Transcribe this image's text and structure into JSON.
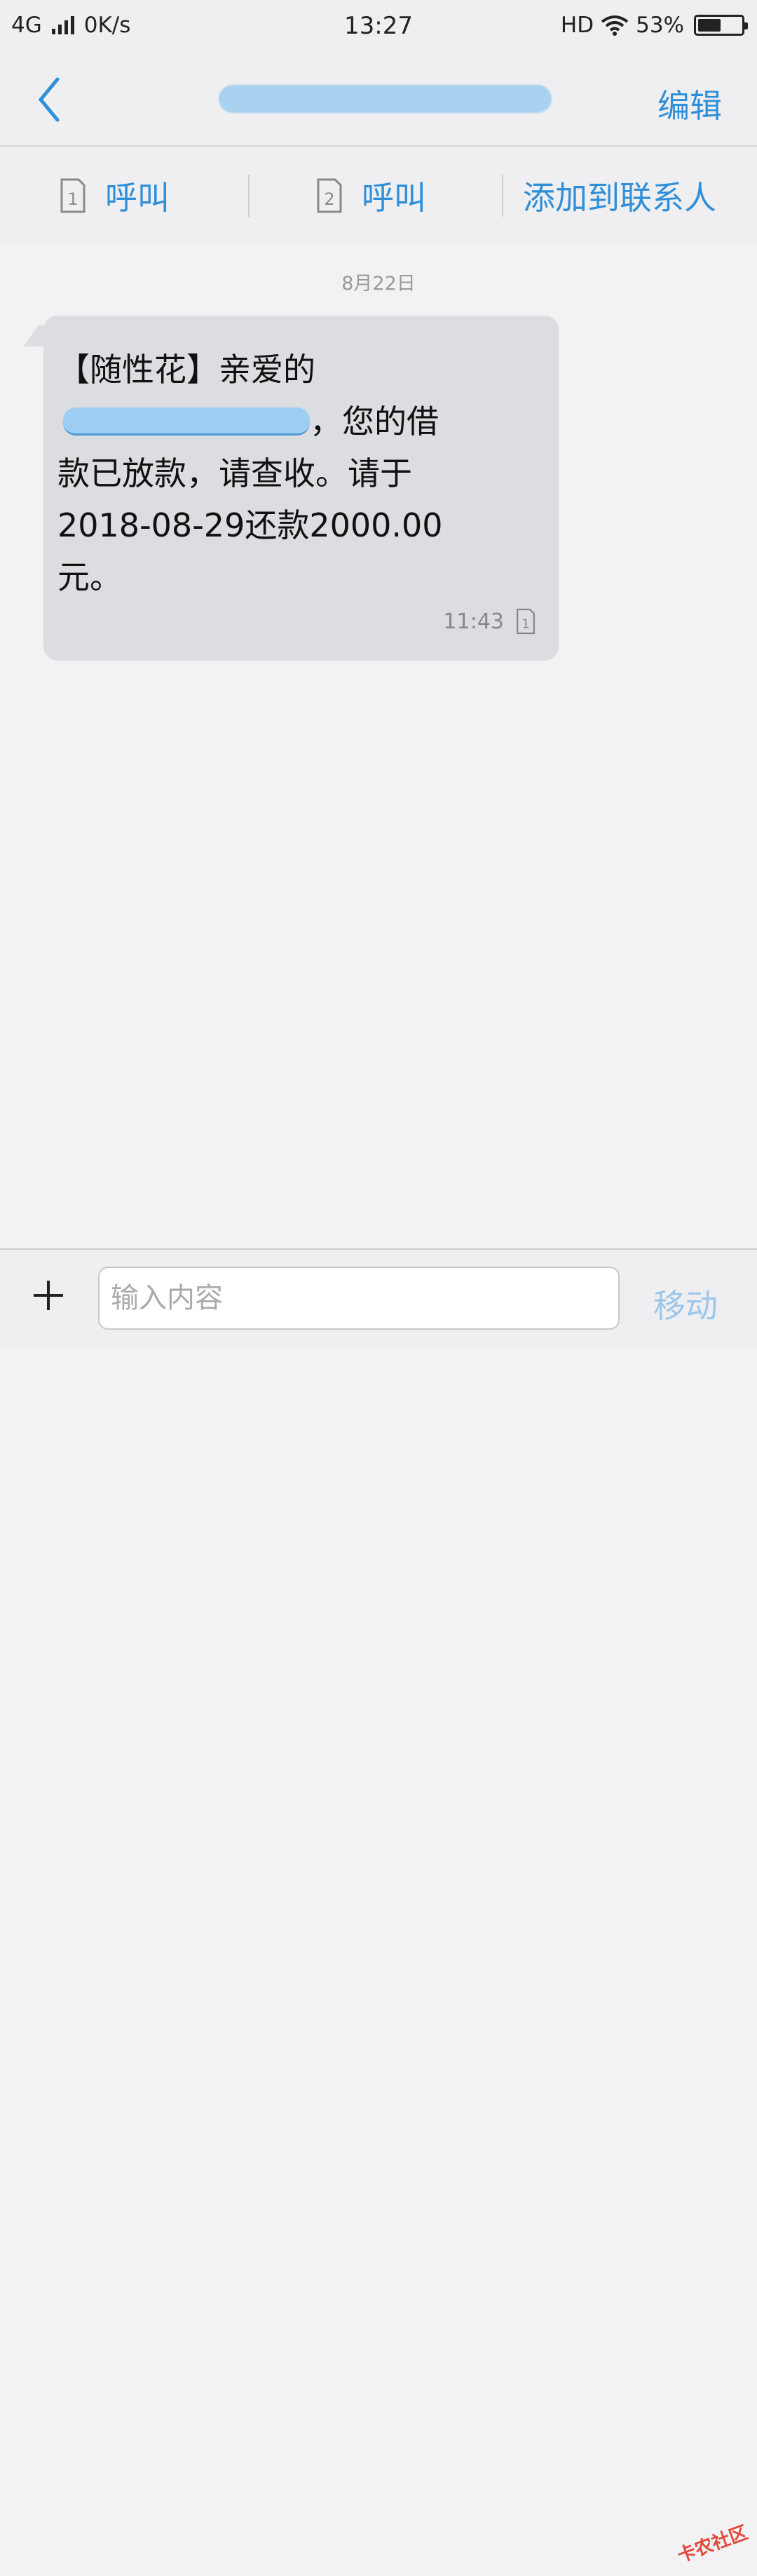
{
  "status_bar": {
    "network": "4G",
    "speed": "0K/s",
    "time": "13:27",
    "hd": "HD",
    "battery_percent_label": "53%",
    "battery_level": 0.53
  },
  "nav": {
    "edit_label": "编辑"
  },
  "actions": {
    "call_sim1_label": "呼叫",
    "call_sim2_label": "呼叫",
    "add_contact_label": "添加到联系人",
    "sim1_number": "1",
    "sim2_number": "2"
  },
  "conversation": {
    "date": "8月22日",
    "message": {
      "line1": "【随性花】亲爱的",
      "line2_suffix": "，您的借",
      "line3": "款已放款，请查收。请于",
      "line4": "2018-08-29还款2000.00",
      "line5": "元。",
      "time": "11:43",
      "sim": "1"
    }
  },
  "input": {
    "placeholder": "输入内容",
    "send_label": "移动"
  },
  "watermark": "卡农社区"
}
